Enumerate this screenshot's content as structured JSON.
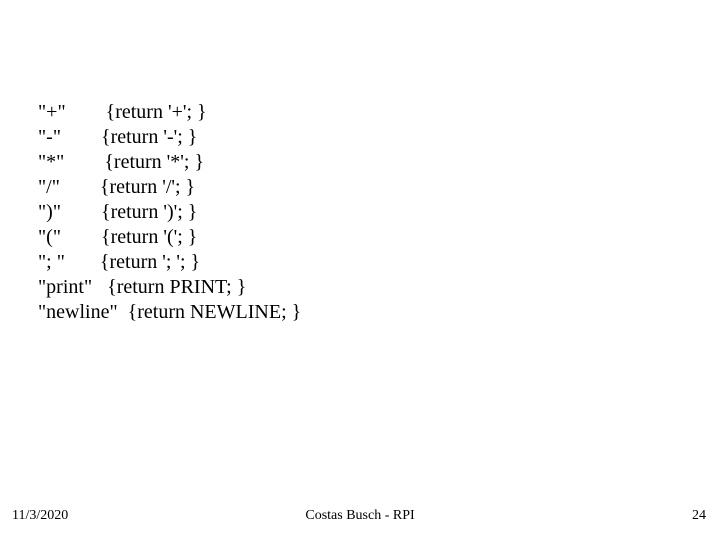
{
  "lines": {
    "l0": "\"+\"        {return '+'; }",
    "l1": "\"-\"        {return '-'; }",
    "l2": "\"*\"        {return '*'; }",
    "l3": "\"/\"        {return '/'; }",
    "l4": "\")\"        {return ')'; }",
    "l5": "\"(\"        {return '('; }",
    "l6": "\"; \"       {return '; '; }",
    "l7": "\"print\"   {return PRINT; }",
    "l8": "\"newline\"  {return NEWLINE; }"
  },
  "footer": {
    "date": "11/3/2020",
    "author": "Costas Busch - RPI",
    "page": "24"
  }
}
